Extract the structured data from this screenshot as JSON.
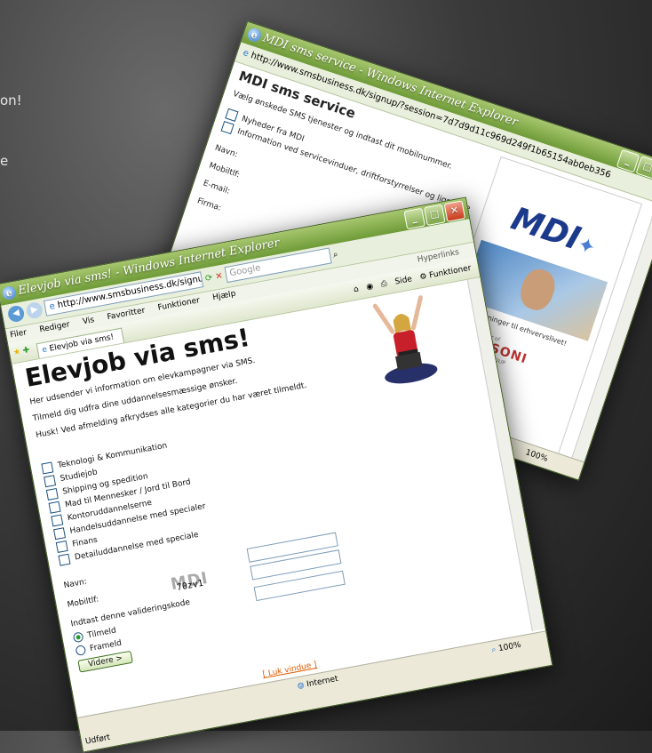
{
  "background": {
    "text_line1": "on!",
    "text_line2": "e"
  },
  "back_window": {
    "title": "MDI sms service - Windows Internet Explorer",
    "url": "http://www.smsbusiness.dk/signup/?session=7d7d9d11c969d249f1b65154ab0eb356",
    "heading": "MDI sms service",
    "intro": "Vælg ønskede SMS tjenester og indtast dit mobilnummer.",
    "options": [
      "Nyheder fra MDI",
      "Information ved servicevinduer, driftforstyrrelser og lignende"
    ],
    "labels": [
      "Navn:",
      "Mobiltlf:",
      "E-mail:",
      "Firma:"
    ],
    "logo_text": "MDI",
    "caption": "- SMS løsninger til erhvervslivet!",
    "partner_small": "Partner of",
    "partner_logo": "KESONI",
    "partner_sub": "GROUP",
    "zoom": "100%"
  },
  "front_window": {
    "title": "Elevjob via sms! - Windows Internet Explorer",
    "url": "http://www.smsbusiness.dk/signup/?sess",
    "search_placeholder": "Google",
    "hyperlinks": "Hyperlinks",
    "menu": [
      "Filer",
      "Rediger",
      "Vis",
      "Favoritter",
      "Funktioner",
      "Hjælp"
    ],
    "tab_label": "Elevjob via sms!",
    "toolbar": {
      "side": "Side",
      "funktioner": "Funktioner"
    },
    "heading": "Elevjob via sms!",
    "paragraphs": [
      "Her udsender vi information om elevkampagner via SMS.",
      "Tilmeld dig udfra dine uddannelsesmæssige ønsker.",
      "Husk! Ved afmelding afkrydses alle kategorier du har været tilmeldt."
    ],
    "categories": [
      "Teknologi & Kommunikation",
      "Studiejob",
      "Shipping og spedition",
      "Mad til Mennesker / Jord til Bord",
      "Kontoruddannelserne",
      "Handelsuddannelse med specialer",
      "Finans",
      "Detailuddannelse med speciale"
    ],
    "navn_label": "Navn:",
    "mobil_label": "Mobiltlf:",
    "captcha_text": "70zv1",
    "captcha_bg": "MDI",
    "validation_label": "Indtast denne valideringskode",
    "radio_options": [
      "Tilmeld",
      "Frameld"
    ],
    "submit_label": "Videre >",
    "close_link": "[ Luk vindue ]",
    "zone": "Internet",
    "zoom": "100%",
    "status": "Udført"
  },
  "colors": {
    "link": "#e05a00",
    "title_green": "#6f9b38",
    "radio_green": "#2b9a2b"
  }
}
